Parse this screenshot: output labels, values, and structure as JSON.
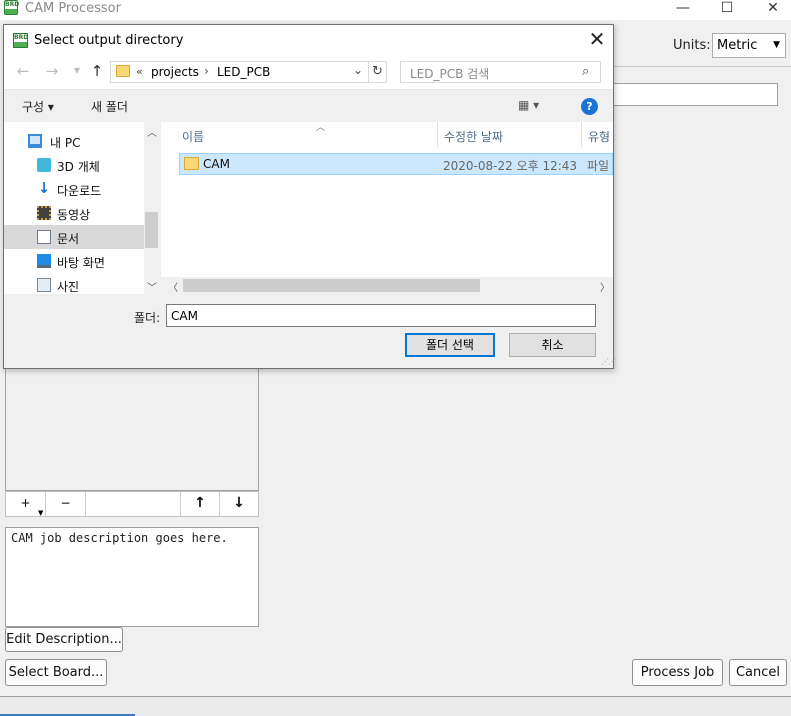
{
  "main_window": {
    "title": "CAM Processor",
    "controls": {
      "minimize": "—",
      "maximize": "☐",
      "close": "✕"
    },
    "units_label": "Units:",
    "units_value": "Metric",
    "list_toolbar": {
      "add": "+",
      "remove": "−",
      "move_up": "🡅",
      "move_down": "🡇"
    },
    "description": "CAM job description goes here.",
    "buttons": {
      "edit_description": "Edit Description...",
      "select_board": "Select Board...",
      "process_job": "Process Job",
      "cancel": "Cancel"
    }
  },
  "dialog": {
    "title": "Select output directory",
    "close": "✕",
    "nav": {
      "back": "←",
      "forward": "→",
      "up": "↑"
    },
    "address": {
      "prefix": "«",
      "segments": [
        "projects",
        "LED_PCB"
      ],
      "separator": "›"
    },
    "search_placeholder": "LED_PCB 검색",
    "commands": {
      "organize": "구성 ▾",
      "new_folder": "새 폴더",
      "view": "▦ ▾",
      "help": "?"
    },
    "nav_items": [
      {
        "label": "내 PC",
        "icon": "pc-icon"
      },
      {
        "label": "3D 개체",
        "icon": "3d-objects-icon"
      },
      {
        "label": "다운로드",
        "icon": "download-icon"
      },
      {
        "label": "동영상",
        "icon": "video-icon"
      },
      {
        "label": "문서",
        "icon": "documents-icon"
      },
      {
        "label": "바탕 화면",
        "icon": "desktop-icon"
      },
      {
        "label": "사진",
        "icon": "pictures-icon"
      }
    ],
    "selected_nav": "문서",
    "columns": {
      "name": "이름",
      "date": "수정한 날짜",
      "type": "유형"
    },
    "files": [
      {
        "name": "CAM",
        "date": "2020-08-22 오후 12:43",
        "type": "파일"
      }
    ],
    "folder_label": "폴더:",
    "folder_value": "CAM",
    "buttons": {
      "select_folder": "폴더 선택",
      "cancel": "취소"
    }
  }
}
